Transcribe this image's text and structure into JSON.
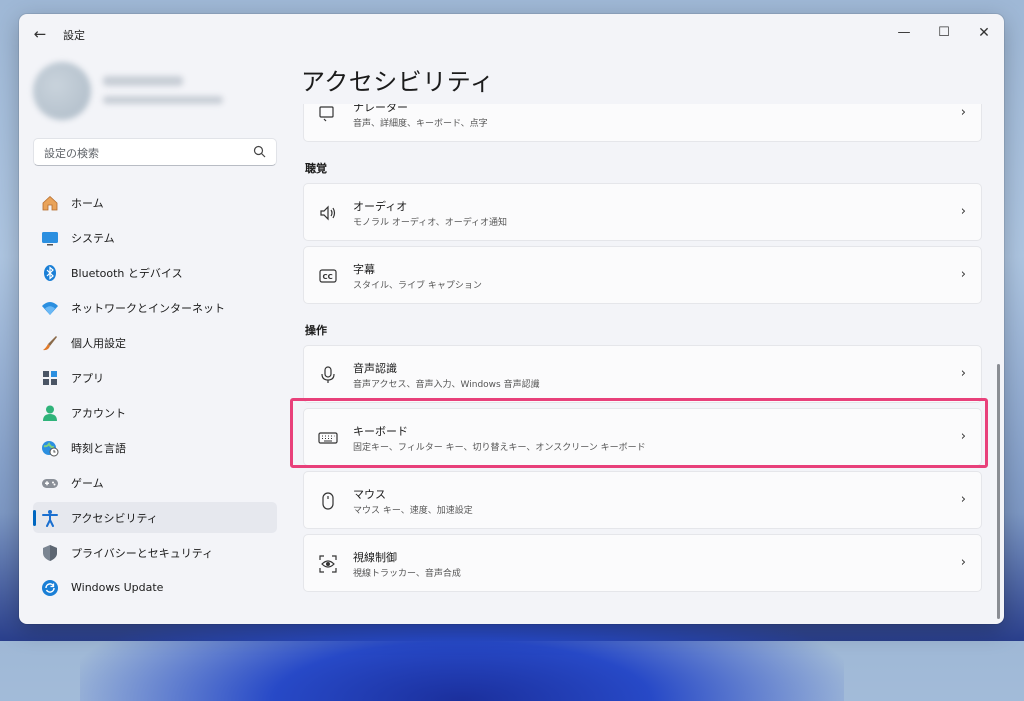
{
  "window": {
    "title": "設定",
    "back": "←",
    "minimize": "—",
    "maximize": "☐",
    "close": "✕"
  },
  "search": {
    "placeholder": "設定の検索"
  },
  "nav": [
    {
      "id": "home",
      "label": "ホーム",
      "icon": "home-icon"
    },
    {
      "id": "system",
      "label": "システム",
      "icon": "monitor-icon"
    },
    {
      "id": "bluetooth",
      "label": "Bluetooth とデバイス",
      "icon": "bluetooth-icon"
    },
    {
      "id": "network",
      "label": "ネットワークとインターネット",
      "icon": "wifi-icon"
    },
    {
      "id": "personalization",
      "label": "個人用設定",
      "icon": "brush-icon"
    },
    {
      "id": "apps",
      "label": "アプリ",
      "icon": "apps-icon"
    },
    {
      "id": "accounts",
      "label": "アカウント",
      "icon": "person-icon"
    },
    {
      "id": "time-language",
      "label": "時刻と言語",
      "icon": "globe-clock-icon"
    },
    {
      "id": "gaming",
      "label": "ゲーム",
      "icon": "gamepad-icon"
    },
    {
      "id": "accessibility",
      "label": "アクセシビリティ",
      "icon": "accessibility-icon",
      "active": true
    },
    {
      "id": "privacy",
      "label": "プライバシーとセキュリティ",
      "icon": "shield-icon"
    },
    {
      "id": "windows-update",
      "label": "Windows Update",
      "icon": "update-icon"
    }
  ],
  "main": {
    "title": "アクセシビリティ",
    "top_card": {
      "title": "ナレーター",
      "subtitle": "音声、詳細度、キーボード、点字",
      "icon": "narrator-icon"
    },
    "section_hearing": "聴覚",
    "audio": {
      "title": "オーディオ",
      "subtitle": "モノラル オーディオ、オーディオ通知",
      "icon": "speaker-icon"
    },
    "captions": {
      "title": "字幕",
      "subtitle": "スタイル、ライブ キャプション",
      "icon": "cc-icon"
    },
    "section_interaction": "操作",
    "speech": {
      "title": "音声認識",
      "subtitle": "音声アクセス、音声入力、Windows 音声認識",
      "icon": "microphone-icon"
    },
    "keyboard": {
      "title": "キーボード",
      "subtitle": "固定キー、フィルター キー、切り替えキー、オンスクリーン キーボード",
      "icon": "keyboard-icon"
    },
    "mouse": {
      "title": "マウス",
      "subtitle": "マウス キー、速度、加速設定",
      "icon": "mouse-icon"
    },
    "eye": {
      "title": "視線制御",
      "subtitle": "視線トラッカー、音声合成",
      "icon": "eye-control-icon"
    },
    "chevron": "›"
  },
  "colors": {
    "accent": "#0067c0",
    "highlight": "#e8407a"
  }
}
